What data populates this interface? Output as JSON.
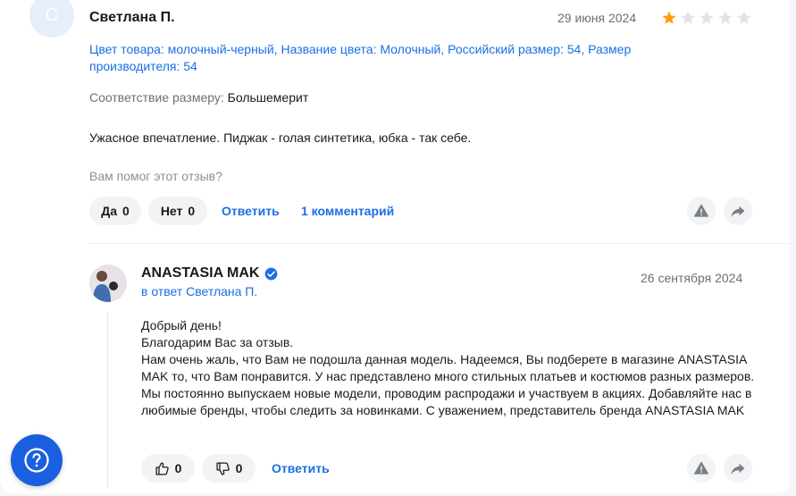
{
  "review": {
    "avatar_letter": "С",
    "author": "Светлана П.",
    "date": "29 июня 2024",
    "rating": 1,
    "max_rating": 5,
    "params_text": "Цвет товара: молочный-черный, Название цвета: Молочный, Российский размер: 54, Размер производителя: 54",
    "fit_key": "Соответствие размеру:",
    "fit_value": "Большемерит",
    "text": "Ужасное впечатление. Пиджак - голая синтетика, юбка - так себе.",
    "helpful_question": "Вам помог этот отзыв?",
    "yes_label": "Да",
    "yes_count": "0",
    "no_label": "Нет",
    "no_count": "0",
    "reply_link": "Ответить",
    "comments_link": "1 комментарий"
  },
  "seller_reply": {
    "name": "ANASTASIA MAK",
    "reply_to": "в ответ Светлана П.",
    "date": "26 сентября 2024",
    "lines": [
      "Добрый день!",
      "Благодарим Вас за отзыв.",
      "Нам очень жаль, что Вам не подошла данная модель. Надеемся, Вы подберете в магазине ANASTASIA MAK то, что Вам понравится. У нас представлено много стильных платьев и костюмов разных размеров. Мы постоянно выпускаем новые модели, проводим распродажи и участвуем в акциях. Добавляйте нас в любимые бренды, чтобы следить за новинками. С уважением, представитель бренда ANASTASIA MAK"
    ],
    "like_count": "0",
    "dislike_count": "0",
    "reply_link": "Ответить"
  },
  "colors": {
    "accent": "#1a6fe6",
    "star_active": "#ff9e0d",
    "star_inactive": "#e0e2e6",
    "fab": "#1a5fe0"
  },
  "icons": {
    "star": "star-icon",
    "report": "warning-triangle-icon",
    "share": "share-arrow-icon",
    "verified": "verified-badge-icon",
    "like": "thumbs-up-icon",
    "dislike": "thumbs-down-icon",
    "help": "question-mark-icon"
  }
}
